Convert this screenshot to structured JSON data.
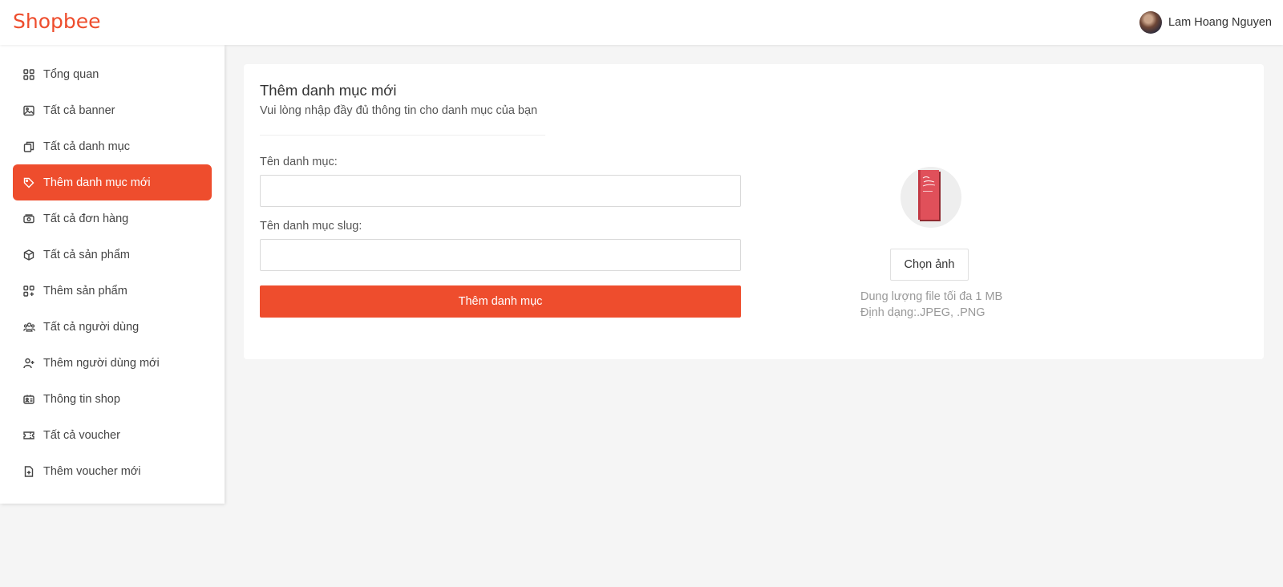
{
  "header": {
    "logo": "Shopbee",
    "user_name": "Lam Hoang Nguyen"
  },
  "sidebar": {
    "items": [
      {
        "label": "Tổng quan",
        "icon": "grid-icon"
      },
      {
        "label": "Tất cả banner",
        "icon": "image-icon"
      },
      {
        "label": "Tất cả danh mục",
        "icon": "copy-icon"
      },
      {
        "label": "Thêm danh mục mới",
        "icon": "tag-icon",
        "active": true
      },
      {
        "label": "Tất cả đơn hàng",
        "icon": "cash-icon"
      },
      {
        "label": "Tất cả sản phẩm",
        "icon": "box-icon"
      },
      {
        "label": "Thêm sản phẩm",
        "icon": "grid-plus-icon"
      },
      {
        "label": "Tất cả người dùng",
        "icon": "users-icon"
      },
      {
        "label": "Thêm người dùng mới",
        "icon": "user-plus-icon"
      },
      {
        "label": "Thông tin shop",
        "icon": "id-card-icon"
      },
      {
        "label": "Tất cả voucher",
        "icon": "ticket-icon"
      },
      {
        "label": "Thêm voucher mới",
        "icon": "file-plus-icon"
      }
    ]
  },
  "form": {
    "title": "Thêm danh mục mới",
    "subtitle": "Vui lòng nhập đầy đủ thông tin cho danh mục của bạn",
    "name_label": "Tên danh mục:",
    "name_value": "",
    "slug_label": "Tên danh mục slug:",
    "slug_value": "",
    "submit_label": "Thêm danh mục"
  },
  "image": {
    "choose_label": "Chọn ảnh",
    "hint_size": "Dung lượng file tối đa 1 MB",
    "hint_format": "Định dạng:.JPEG, .PNG"
  },
  "colors": {
    "accent": "#ee4d2d",
    "background": "#f5f5f5"
  }
}
